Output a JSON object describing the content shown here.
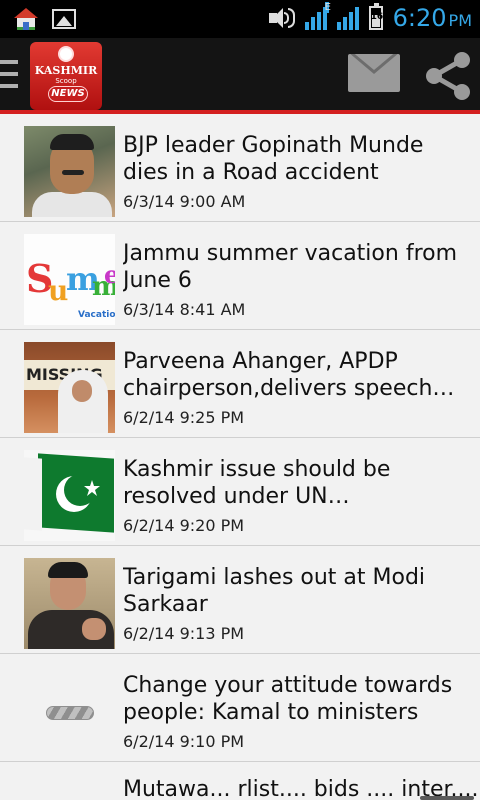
{
  "status_bar": {
    "time": "6:20",
    "ampm": "PM",
    "battery": "16",
    "network": "E",
    "icons": [
      "home-icon",
      "gallery-icon",
      "volume-icon",
      "signal-icon",
      "battery-icon"
    ]
  },
  "action_bar": {
    "logo": {
      "line1": "KASHMIR",
      "line2": "Scoop",
      "line3": "NEWS"
    },
    "icons": [
      "menu-icon",
      "mail-icon",
      "share-icon"
    ],
    "accent_color": "#d42020"
  },
  "news": [
    {
      "title": "BJP leader Gopinath Munde dies in a Road accident",
      "date": "6/3/14 9:00 AM"
    },
    {
      "title": "Jammu summer vacation from June 6",
      "date": "6/3/14 8:41 AM"
    },
    {
      "title": "Parveena Ahanger, APDP chairperson,delivers speech…",
      "date": "6/2/14 9:25 PM"
    },
    {
      "title": "Kashmir issue should be resolved under UN…",
      "date": "6/2/14 9:20 PM"
    },
    {
      "title": "Tarigami lashes out at Modi Sarkaar",
      "date": "6/2/14 9:13 PM"
    },
    {
      "title": "Change your attitude towards people: Kamal to ministers",
      "date": "6/2/14 9:10 PM"
    },
    {
      "title": "Mutawa... rlist.... bids .... inter.... nl"
    }
  ],
  "thumbs": {
    "summer_text": "Summe",
    "summer_sub": "Vacatio",
    "parveena_board": "MISSING"
  }
}
